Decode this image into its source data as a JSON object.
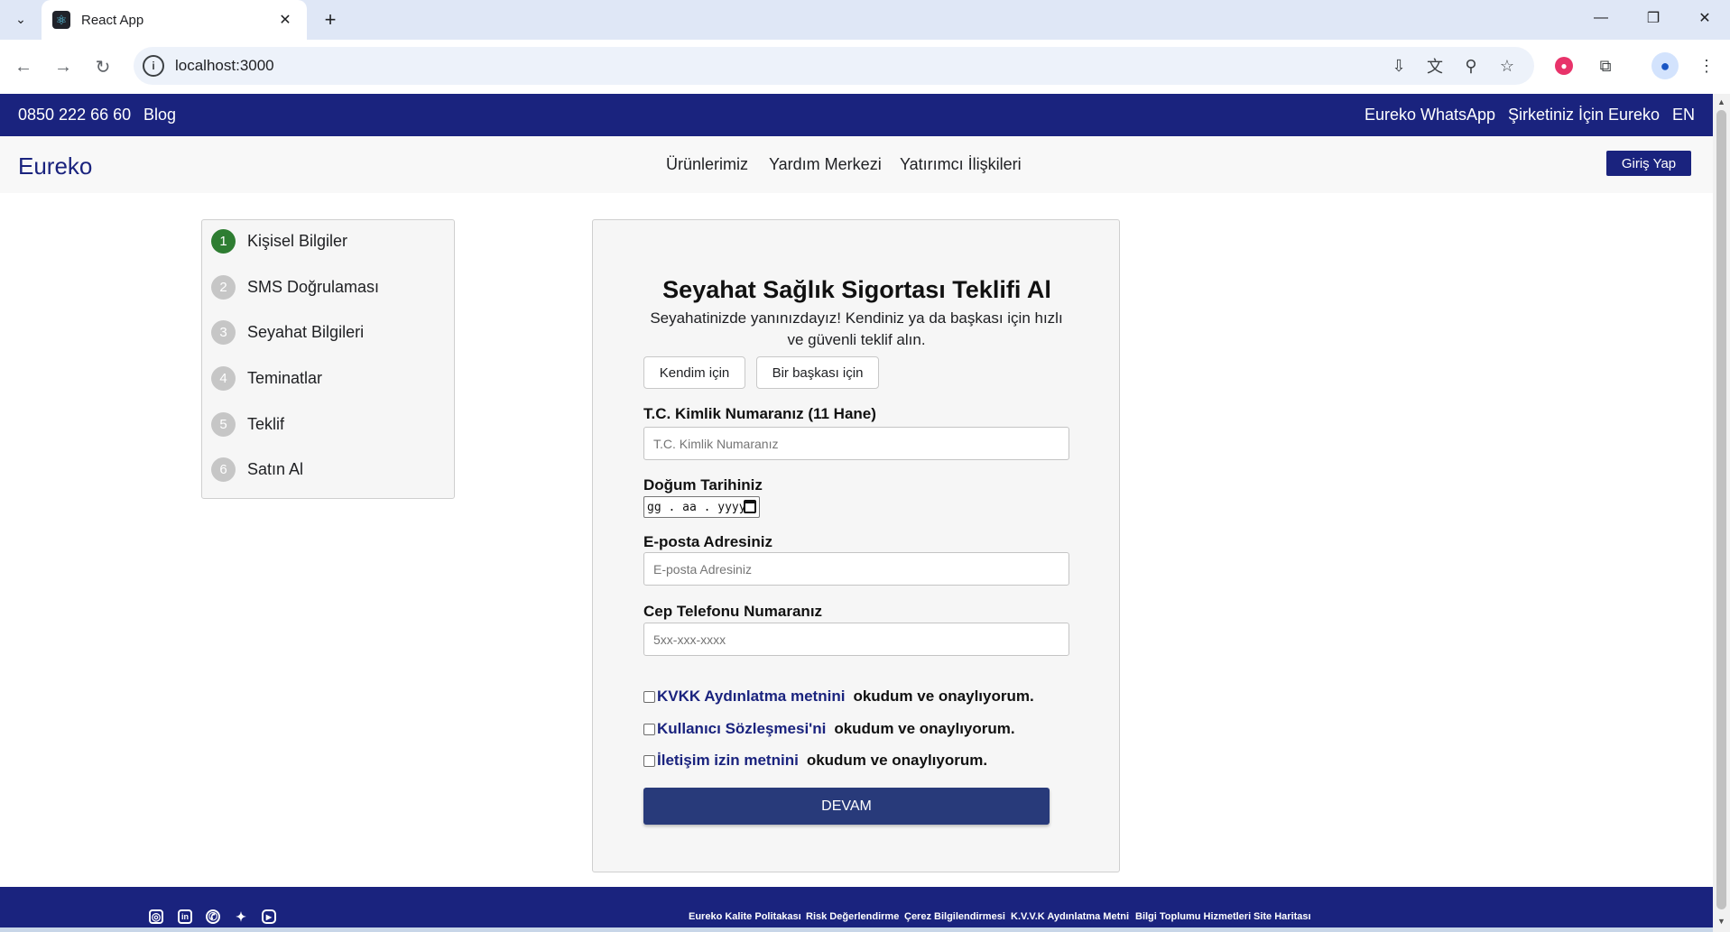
{
  "browser": {
    "tab_title": "React App",
    "url": "localhost:3000"
  },
  "topbar": {
    "phone": "0850 222 66 60",
    "blog": "Blog",
    "whatsapp": "Eureko WhatsApp",
    "corporate": "Şirketiniz İçin Eureko",
    "language": "EN"
  },
  "nav": {
    "brand": "Eureko",
    "links": [
      "Ürünlerimiz",
      "Yardım Merkezi",
      "Yatırımcı İlişkileri"
    ],
    "login": "Giriş Yap"
  },
  "steps": [
    {
      "num": "1",
      "label": "Kişisel Bilgiler",
      "active": true
    },
    {
      "num": "2",
      "label": "SMS Doğrulaması",
      "active": false
    },
    {
      "num": "3",
      "label": "Seyahat Bilgileri",
      "active": false
    },
    {
      "num": "4",
      "label": "Teminatlar",
      "active": false
    },
    {
      "num": "5",
      "label": "Teklif",
      "active": false
    },
    {
      "num": "6",
      "label": "Satın Al",
      "active": false
    }
  ],
  "form": {
    "title": "Seyahat Sağlık Sigortası Teklifi Al",
    "subtitle": "Seyahatinizde yanınızdayız! Kendiniz ya da başkası için hızlı ve güvenli teklif alın.",
    "choice_self": "Kendim için",
    "choice_other": "Bir başkası için",
    "tc_label": "T.C. Kimlik Numaranız (11 Hane)",
    "tc_placeholder": "T.C. Kimlik Numaranız",
    "dob_label": "Doğum Tarihiniz",
    "dob_placeholder": "gg . aa . yyyy",
    "email_label": "E-posta Adresiniz",
    "email_placeholder": "E-posta Adresiniz",
    "phone_label": "Cep Telefonu Numaranız",
    "phone_placeholder": "5xx-xxx-xxxx",
    "consents": [
      {
        "link": "KVKK Aydınlatma metnini",
        "text": "okudum ve onaylıyorum."
      },
      {
        "link": "Kullanıcı Sözleşmesi'ni",
        "text": "okudum ve onaylıyorum."
      },
      {
        "link": "İletişim izin metnini",
        "text": "okudum ve onaylıyorum."
      }
    ],
    "submit": "DEVAM"
  },
  "footer": {
    "links": [
      "Eureko Kalite Politakası",
      "Risk Değerlendirme",
      "Çerez Bilgilendirmesi",
      "K.V.V.K Aydınlatma Metni",
      "Bilgi Toplumu Hizmetleri",
      "Site Haritası"
    ],
    "social_icons": [
      "instagram-icon",
      "linkedin-icon",
      "whatsapp-icon",
      "twitter-icon",
      "youtube-icon"
    ]
  },
  "colors": {
    "brand_navy": "#1a237e",
    "button_navy": "#283a7a",
    "step_active": "#2e7d32",
    "step_inactive": "#c6c6c6"
  }
}
